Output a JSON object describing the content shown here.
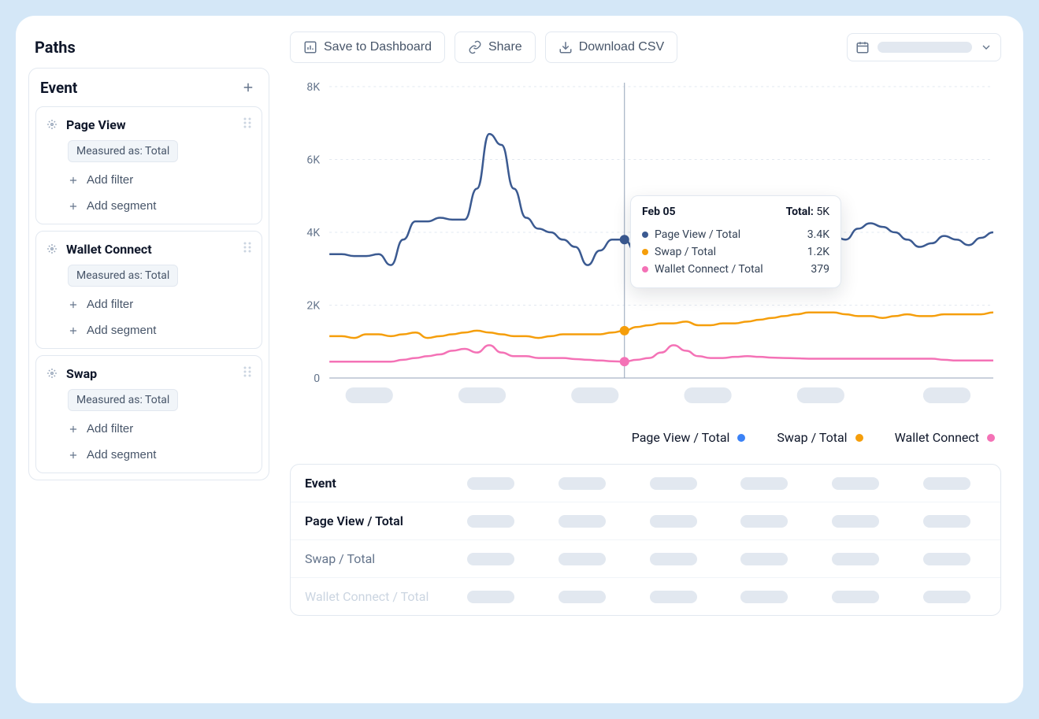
{
  "sidebar": {
    "title": "Paths",
    "panel_title": "Event",
    "events": [
      {
        "name": "Page View",
        "measured": "Measured as: Total",
        "add_filter": "Add filter",
        "add_segment": "Add segment"
      },
      {
        "name": "Wallet Connect",
        "measured": "Measured as: Total",
        "add_filter": "Add filter",
        "add_segment": "Add segment"
      },
      {
        "name": "Swap",
        "measured": "Measured as: Total",
        "add_filter": "Add filter",
        "add_segment": "Add segment"
      }
    ]
  },
  "toolbar": {
    "save": "Save to Dashboard",
    "share": "Share",
    "download": "Download CSV"
  },
  "tooltip": {
    "date": "Feb 05",
    "total_label": "Total:",
    "total_value": "5K",
    "rows": [
      {
        "label": "Page View / Total",
        "value": "3.4K",
        "color": "#3b5a91"
      },
      {
        "label": "Swap / Total",
        "value": "1.2K",
        "color": "#f59e0b"
      },
      {
        "label": "Wallet Connect / Total",
        "value": "379",
        "color": "#f472b6"
      }
    ]
  },
  "legend": [
    {
      "label": "Page View / Total",
      "color": "#3b82f6"
    },
    {
      "label": "Swap / Total",
      "color": "#f59e0b"
    },
    {
      "label": "Wallet Connect",
      "color": "#f472b6"
    }
  ],
  "table": {
    "header": "Event",
    "rows": [
      "Page View / Total",
      "Swap / Total",
      "Wallet Connect / Total"
    ]
  },
  "chart_data": {
    "type": "line",
    "ylabel": "",
    "ylim": [
      0,
      8000
    ],
    "yticks": [
      "0",
      "2K",
      "4K",
      "6K",
      "8K"
    ],
    "hover_index": 24,
    "x": [
      0,
      1,
      2,
      3,
      4,
      5,
      6,
      7,
      8,
      9,
      10,
      11,
      12,
      13,
      14,
      15,
      16,
      17,
      18,
      19,
      20,
      21,
      22,
      23,
      24,
      25,
      26,
      27,
      28,
      29,
      30,
      31,
      32,
      33,
      34,
      35,
      36,
      37,
      38,
      39,
      40,
      41,
      42,
      43,
      44,
      45,
      46,
      47,
      48,
      49,
      50,
      51,
      52,
      53,
      54
    ],
    "series": [
      {
        "name": "Page View / Total",
        "color": "#3b5a91",
        "values": [
          3400,
          3400,
          3350,
          3350,
          3400,
          3100,
          3800,
          4300,
          4300,
          4400,
          4350,
          4350,
          5200,
          6700,
          6400,
          5200,
          4400,
          4100,
          4000,
          3800,
          3600,
          3100,
          3500,
          3800,
          3800,
          3400,
          3600,
          3400,
          3200,
          3700,
          3500,
          3700,
          3900,
          3800,
          3700,
          3500,
          3600,
          3700,
          3700,
          3600,
          3800,
          3900,
          3800,
          4100,
          4250,
          4150,
          4000,
          3800,
          3600,
          3700,
          3900,
          3800,
          3650,
          3850,
          4000
        ]
      },
      {
        "name": "Swap / Total",
        "color": "#f59e0b",
        "values": [
          1150,
          1150,
          1100,
          1200,
          1200,
          1150,
          1200,
          1250,
          1100,
          1150,
          1200,
          1250,
          1300,
          1250,
          1200,
          1150,
          1150,
          1100,
          1150,
          1200,
          1200,
          1200,
          1200,
          1250,
          1300,
          1400,
          1450,
          1500,
          1500,
          1550,
          1450,
          1450,
          1500,
          1500,
          1550,
          1600,
          1650,
          1700,
          1750,
          1800,
          1800,
          1800,
          1750,
          1700,
          1700,
          1650,
          1700,
          1750,
          1700,
          1700,
          1750,
          1750,
          1750,
          1750,
          1800
        ]
      },
      {
        "name": "Wallet Connect / Total",
        "color": "#f472b6",
        "values": [
          450,
          450,
          450,
          450,
          450,
          450,
          500,
          550,
          600,
          650,
          750,
          800,
          700,
          900,
          700,
          600,
          600,
          550,
          550,
          550,
          520,
          500,
          480,
          460,
          450,
          500,
          550,
          700,
          900,
          750,
          600,
          550,
          550,
          580,
          600,
          580,
          560,
          550,
          540,
          530,
          530,
          530,
          530,
          530,
          530,
          530,
          530,
          530,
          530,
          530,
          500,
          480,
          480,
          480,
          480
        ]
      }
    ]
  }
}
